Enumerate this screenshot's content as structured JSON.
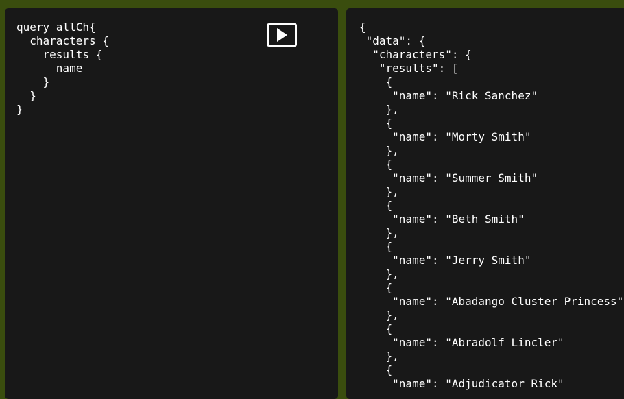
{
  "query_editor": {
    "lines": [
      "query allCh{",
      "  characters {",
      "    results {",
      "      name",
      "    }",
      "  }",
      "}"
    ]
  },
  "run_button": {
    "icon": "play-icon"
  },
  "result_viewer": {
    "lines": [
      "{",
      " \"data\": {",
      "  \"characters\": {",
      "   \"results\": [",
      "    {",
      "     \"name\": \"Rick Sanchez\"",
      "    },",
      "    {",
      "     \"name\": \"Morty Smith\"",
      "    },",
      "    {",
      "     \"name\": \"Summer Smith\"",
      "    },",
      "    {",
      "     \"name\": \"Beth Smith\"",
      "    },",
      "    {",
      "     \"name\": \"Jerry Smith\"",
      "    },",
      "    {",
      "     \"name\": \"Abadango Cluster Princess\"",
      "    },",
      "    {",
      "     \"name\": \"Abradolf Lincler\"",
      "    },",
      "    {",
      "     \"name\": \"Adjudicator Rick\""
    ]
  },
  "colors": {
    "background": "#3a4d0e",
    "panel": "#181818",
    "text": "#ffffff"
  }
}
